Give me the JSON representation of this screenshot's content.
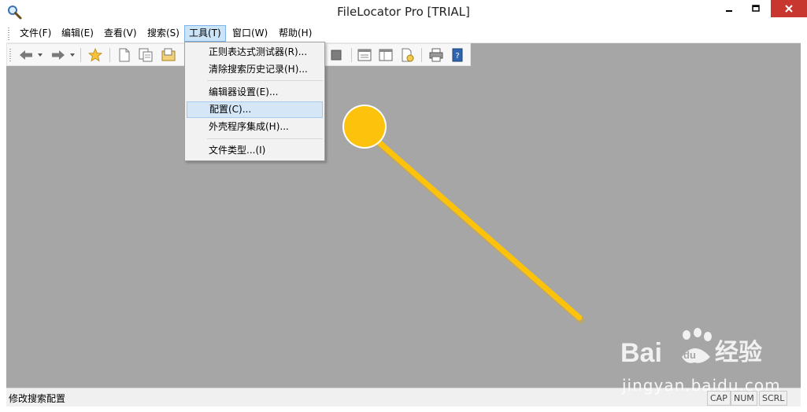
{
  "window": {
    "title": "FileLocator Pro [TRIAL]"
  },
  "menubar": {
    "items": [
      {
        "label": "文件(F)"
      },
      {
        "label": "编辑(E)"
      },
      {
        "label": "查看(V)"
      },
      {
        "label": "搜索(S)"
      },
      {
        "label": "工具(T)"
      },
      {
        "label": "窗口(W)"
      },
      {
        "label": "帮助(H)"
      }
    ],
    "active_index": 4
  },
  "toolbar": {
    "icons": [
      "back-arrow-icon",
      "forward-arrow-icon",
      "favorites-star-icon",
      "new-document-icon",
      "copy-document-icon",
      "open-folder-icon",
      "stop-icon",
      "results-view-icon",
      "layout-view-icon",
      "document-settings-icon",
      "print-icon",
      "help-book-icon"
    ]
  },
  "tools_menu": {
    "items": [
      {
        "label": "正则表达式测试器(R)..."
      },
      {
        "label": "清除搜索历史记录(H)..."
      },
      {
        "label": "编辑器设置(E)..."
      },
      {
        "label": "配置(C)..."
      },
      {
        "label": "外壳程序集成(H)..."
      },
      {
        "label": "文件类型...(I)"
      }
    ],
    "hovered_index": 3
  },
  "statusbar": {
    "text": "修改搜索配置",
    "indicators": [
      "CAP",
      "NUM",
      "SCRL"
    ]
  },
  "watermark": {
    "url": "jingyan.baidu.com",
    "logo_text": "Bai du 经验"
  },
  "colors": {
    "content_bg": "#a6a6a6",
    "annotation": "#fdc30c",
    "close_btn": "#c7372f",
    "menu_highlight": "#cce4f7"
  }
}
